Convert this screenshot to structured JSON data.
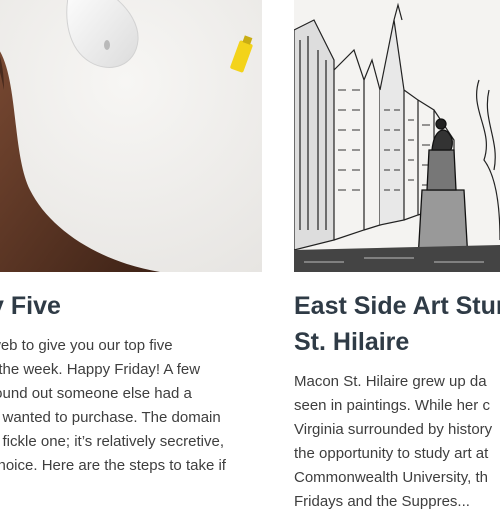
{
  "cards": [
    {
      "title": "y Five",
      "excerpt_lines": [
        "web to give you our top five",
        "f the week. Happy Friday!   A few",
        "found out someone else had a",
        "e wanted to purchase. The domain",
        "a fickle one; it’s relatively secretive,",
        "choice. Here are the steps to take if"
      ],
      "image": "desk-hand-mouse-photo"
    },
    {
      "title_lines": [
        "East Side Art Stur",
        "St. Hilaire"
      ],
      "excerpt_lines": [
        "Macon St. Hilaire grew up da",
        "seen in paintings. While her c",
        "Virginia surrounded by history",
        "the opportunity to study art at",
        "Commonwealth University, th",
        "Fridays and the Suppres..."
      ],
      "image": "street-sketch-illustration"
    }
  ]
}
